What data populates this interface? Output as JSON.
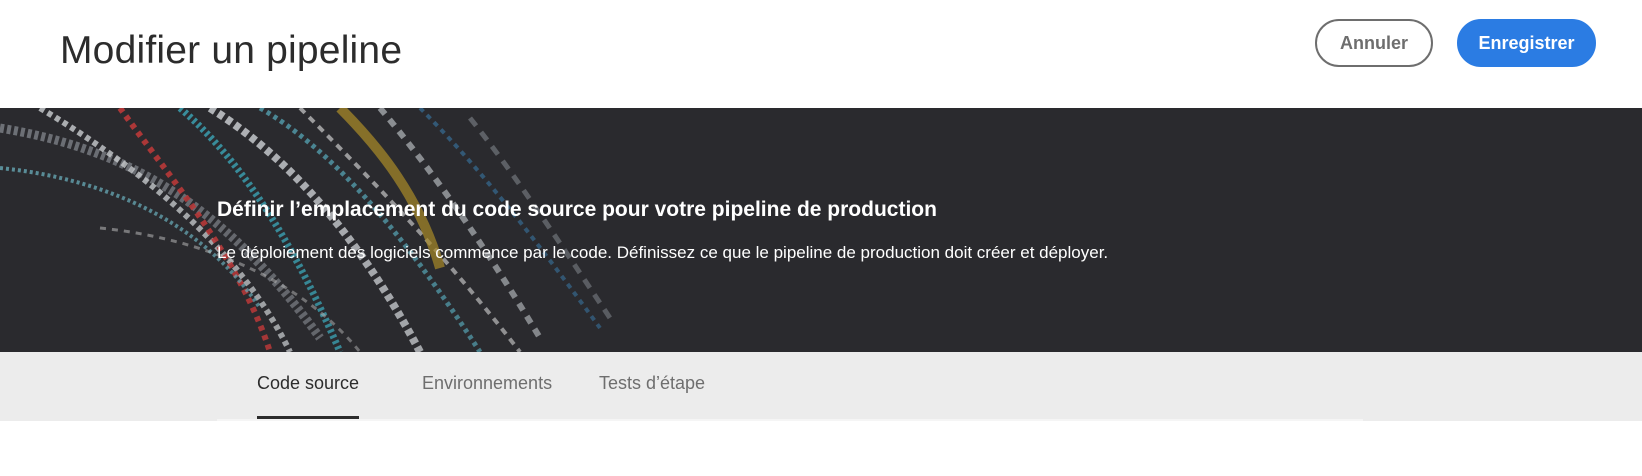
{
  "header": {
    "title": "Modifier un pipeline",
    "cancel_label": "Annuler",
    "save_label": "Enregistrer"
  },
  "banner": {
    "heading": "Définir l’emplacement du code source pour votre pipeline de production",
    "description": "Le déploiement des logiciels commence par le code. Définissez ce que le pipeline de production doit créer et déployer."
  },
  "tabs": [
    {
      "label": "Code source",
      "active": true
    },
    {
      "label": "Environnements",
      "active": false
    },
    {
      "label": "Tests d’étape",
      "active": false
    }
  ],
  "colors": {
    "primary": "#2b7ce3",
    "banner_bg": "#2a2a2e",
    "tabs_bg": "#ececec"
  }
}
